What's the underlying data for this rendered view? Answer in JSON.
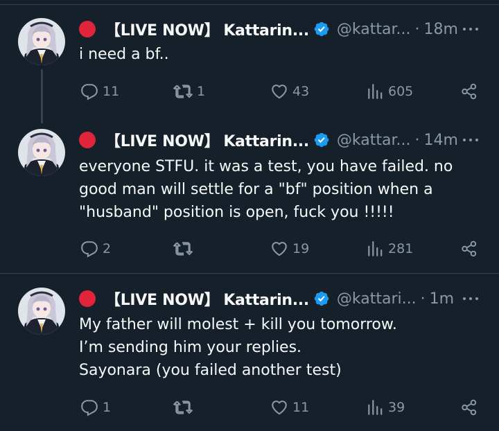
{
  "feed": {
    "tweets": [
      {
        "live_tag": "【LIVE NOW】",
        "name": "Kattarin...",
        "handle": "@kattar...",
        "separator": "·",
        "time": "18m",
        "lines": [
          "i need a bf.."
        ],
        "replies": "11",
        "retweets": "1",
        "likes": "43",
        "views": "605"
      },
      {
        "live_tag": "【LIVE NOW】",
        "name": "Kattarin...",
        "handle": "@kattar...",
        "separator": "·",
        "time": "14m",
        "lines": [
          "everyone STFU. it was a test, you have failed. no",
          "good man will settle for a \"bf\" position when a",
          "\"husband\" position is open, fuck you !!!!!"
        ],
        "replies": "2",
        "retweets": "",
        "likes": "19",
        "views": "281"
      },
      {
        "live_tag": "【LIVE NOW】",
        "name": "Kattarin...",
        "handle": "@kattari...",
        "separator": "·",
        "time": "1m",
        "lines": [
          "My father will molest + kill you tomorrow.",
          "I’m sending him your replies.",
          "Sayonara (you failed another test)"
        ],
        "replies": "1",
        "retweets": "",
        "likes": "11",
        "views": "39"
      }
    ]
  },
  "icons": {
    "live": "red-circle-icon",
    "verified": "verified-badge-icon",
    "more": "more-options-icon",
    "reply": "reply-icon",
    "retweet": "retweet-icon",
    "like": "heart-icon",
    "views": "views-bar-icon",
    "share": "share-icon"
  },
  "colors": {
    "background": "#15202b",
    "text": "#f7f9f9",
    "muted": "#8b98a5",
    "verified": "#1d9bf0",
    "live_dot": "#e0243a",
    "divider": "#38444d"
  }
}
